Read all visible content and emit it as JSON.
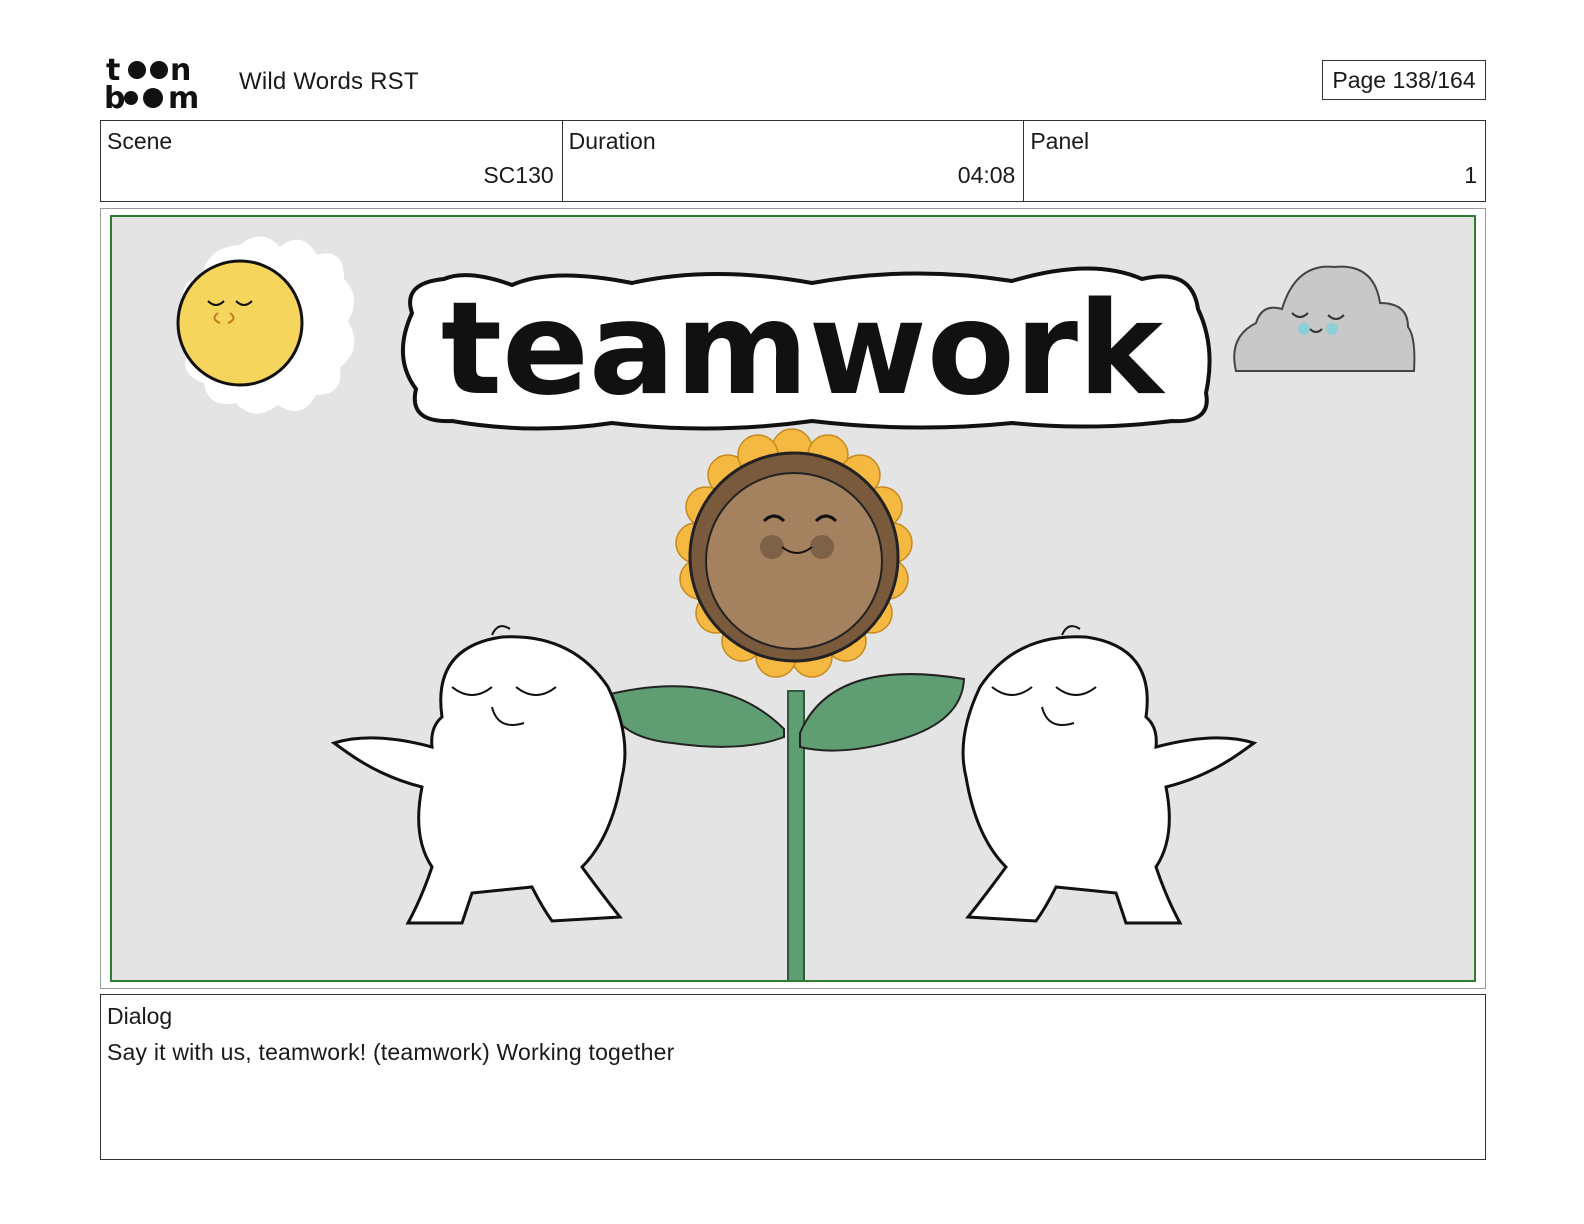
{
  "header": {
    "logo_text": "toon boom",
    "project_title": "Wild Words RST",
    "page_label": "Page 138/164"
  },
  "info": {
    "scene_label": "Scene",
    "scene_value": "SC130",
    "duration_label": "Duration",
    "duration_value": "04:08",
    "panel_label": "Panel",
    "panel_value": "1"
  },
  "panel": {
    "title_word": "teamwork",
    "colors": {
      "background": "#e4e4e4",
      "frame": "#2e7d32",
      "sun": "#f6d55c",
      "petals": "#f5b942",
      "flower_center": "#a5825f",
      "leaf": "#5f9e72",
      "cloud": "#c8c8c8"
    },
    "icons": [
      "sun-icon",
      "cloud-icon",
      "sunflower-icon",
      "character-left",
      "character-right"
    ]
  },
  "dialog": {
    "label": "Dialog",
    "text": "Say it with us, teamwork! (teamwork) Working together"
  }
}
